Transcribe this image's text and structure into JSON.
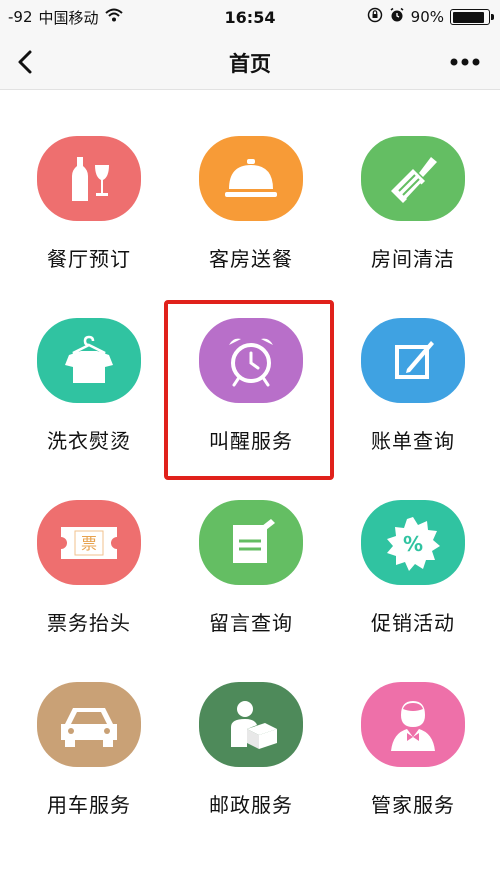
{
  "status_bar": {
    "signal": "-92",
    "carrier": "中国移动",
    "time": "16:54",
    "battery_percent": "90%",
    "battery_level": 0.9,
    "icons": [
      "wifi-icon",
      "orientation-lock-icon",
      "alarm-icon",
      "battery-icon"
    ]
  },
  "nav": {
    "title": "首页",
    "back_icon": "chevron-left-icon",
    "more_icon": "more-dots-icon"
  },
  "grid": {
    "items": [
      {
        "label": "餐厅预订",
        "icon": "wine-bottle-glass-icon",
        "color": "#ee6f6f"
      },
      {
        "label": "客房送餐",
        "icon": "service-bell-icon",
        "color": "#f79b37"
      },
      {
        "label": "房间清洁",
        "icon": "broom-icon",
        "color": "#64be63"
      },
      {
        "label": "洗衣熨烫",
        "icon": "shirt-hanger-icon",
        "color": "#30c3a1"
      },
      {
        "label": "叫醒服务",
        "icon": "alarm-clock-icon",
        "color": "#b86fc9"
      },
      {
        "label": "账单查询",
        "icon": "edit-note-icon",
        "color": "#3fa2e2"
      },
      {
        "label": "票务抬头",
        "icon": "ticket-icon",
        "color": "#ee6f6f",
        "ticket_text": "票"
      },
      {
        "label": "留言查询",
        "icon": "message-note-icon",
        "color": "#64be63"
      },
      {
        "label": "促销活动",
        "icon": "discount-badge-icon",
        "color": "#30c3a1",
        "badge_text": "%"
      },
      {
        "label": "用车服务",
        "icon": "car-icon",
        "color": "#c9a176"
      },
      {
        "label": "邮政服务",
        "icon": "courier-parcel-icon",
        "color": "#4e8a5a"
      },
      {
        "label": "管家服务",
        "icon": "butler-icon",
        "color": "#ee70a9"
      }
    ]
  },
  "highlight_color": "#e0211b"
}
